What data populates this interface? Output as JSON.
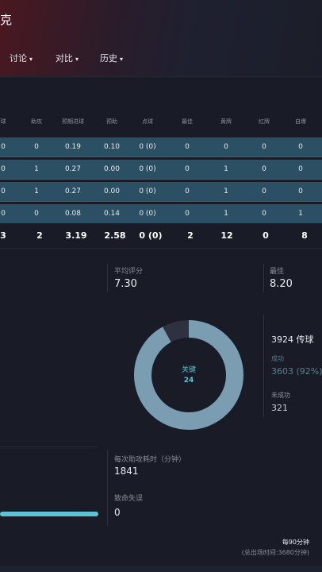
{
  "header": {
    "title": "克",
    "tabs": [
      {
        "label": "讨论"
      },
      {
        "label": "对比"
      },
      {
        "label": "历史"
      }
    ]
  },
  "stats": {
    "columns": [
      "球",
      "助攻",
      "预期进球",
      "预助",
      "点球",
      "最佳",
      "黄牌",
      "红牌",
      "自爆"
    ],
    "rows": [
      [
        "0",
        "0",
        "0.19",
        "0.10",
        "0 (0)",
        "0",
        "0",
        "0",
        "0"
      ],
      [
        "0",
        "1",
        "0.27",
        "0.00",
        "0 (0)",
        "0",
        "1",
        "0",
        "0"
      ],
      [
        "0",
        "1",
        "0.27",
        "0.00",
        "0 (0)",
        "0",
        "1",
        "0",
        "0"
      ],
      [
        "0",
        "0",
        "0.08",
        "0.14",
        "0 (0)",
        "0",
        "1",
        "0",
        "1"
      ]
    ],
    "totals": [
      "3",
      "2",
      "3.19",
      "2.58",
      "0 (0)",
      "2",
      "12",
      "0",
      "8"
    ]
  },
  "ratings": {
    "avg_label": "平均评分",
    "avg_value": "7.30",
    "best_label": "最佳",
    "best_value": "8.20"
  },
  "passes": {
    "donut_label": "关键",
    "donut_value": "24",
    "total_text": "3924 传球",
    "success_label": "成功",
    "success_value": "3603 (92%)",
    "fail_label": "未成功",
    "fail_value": "321",
    "success_fraction": 0.92
  },
  "misc": {
    "minutes_label": "每次助攻耗时（分钟）",
    "minutes_value": "1841",
    "errors_label": "致命失误",
    "errors_value": "0",
    "bar_fraction": 1.0,
    "per90_label": "每90分钟",
    "total_time_label": "(总出场时间:3680分钟)"
  },
  "colors": {
    "accent": "#5ec2d6",
    "donut_ring": "#7a9db1",
    "row_highlight": "#2b4f63"
  }
}
